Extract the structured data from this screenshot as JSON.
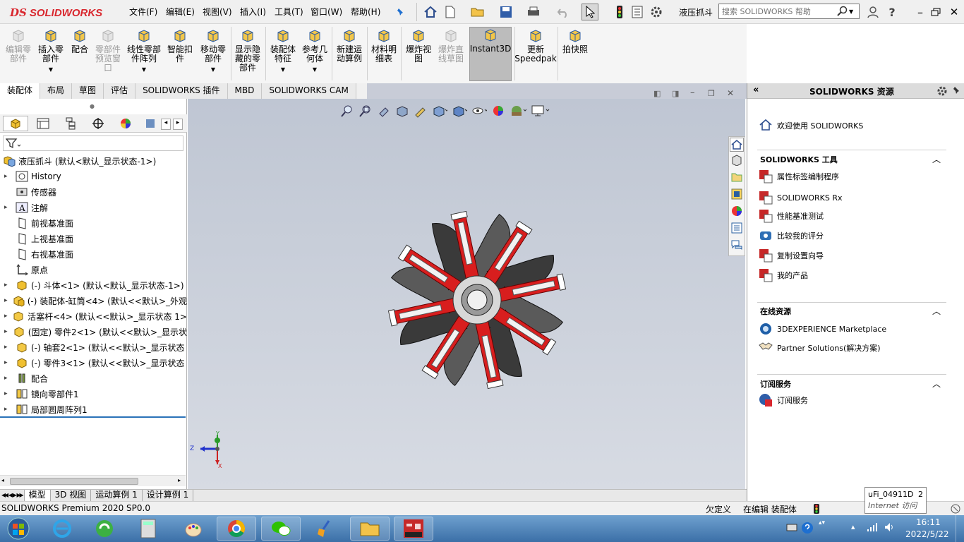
{
  "app": {
    "logo_ds": "DS",
    "logo_text": "SOLIDWORKS",
    "doc_name": "液压抓斗"
  },
  "menu": [
    "文件(F)",
    "编辑(E)",
    "视图(V)",
    "插入(I)",
    "工具(T)",
    "窗口(W)",
    "帮助(H)"
  ],
  "help_search": {
    "placeholder": "搜索 SOLIDWORKS 帮助"
  },
  "ribbon": [
    {
      "label": "编辑零\n部件",
      "disabled": true,
      "icon": "edit-component-icon"
    },
    {
      "label": "插入零\n部件",
      "disabled": false,
      "icon": "insert-component-icon",
      "arrow": true
    },
    {
      "label": "配合",
      "disabled": false,
      "icon": "mate-icon"
    },
    {
      "label": "零部件\n预览窗\n口",
      "disabled": true,
      "icon": "component-preview-icon"
    },
    {
      "label": "线性零部\n件阵列",
      "disabled": false,
      "icon": "linear-pattern-icon",
      "arrow": true
    },
    {
      "label": "智能扣\n件",
      "disabled": false,
      "icon": "smart-fastener-icon"
    },
    {
      "label": "移动零\n部件",
      "disabled": false,
      "icon": "move-component-icon",
      "arrow": true
    },
    {
      "label": "显示隐\n藏的零\n部件",
      "disabled": false,
      "icon": "show-hidden-icon"
    },
    {
      "label": "装配体\n特征",
      "disabled": false,
      "icon": "assembly-feature-icon",
      "arrow": true
    },
    {
      "label": "参考几\n何体",
      "disabled": false,
      "icon": "reference-geometry-icon",
      "arrow": true
    },
    {
      "label": "新建运\n动算例",
      "disabled": false,
      "icon": "motion-study-icon"
    },
    {
      "label": "材料明\n细表",
      "disabled": false,
      "icon": "bom-icon"
    },
    {
      "label": "爆炸视\n图",
      "disabled": false,
      "icon": "exploded-view-icon"
    },
    {
      "label": "爆炸直\n线草图",
      "disabled": true,
      "icon": "explode-line-icon"
    },
    {
      "label": "Instant3D",
      "disabled": false,
      "icon": "instant3d-icon"
    },
    {
      "label": "更新\nSpeedpak",
      "disabled": false,
      "icon": "speedpak-icon"
    },
    {
      "label": "拍快照",
      "disabled": false,
      "icon": "snapshot-icon"
    }
  ],
  "tabs": [
    "装配体",
    "布局",
    "草图",
    "评估",
    "SOLIDWORKS 插件",
    "MBD",
    "SOLIDWORKS CAM"
  ],
  "tree": {
    "root": "液压抓斗  (默认<默认_显示状态-1>)",
    "items": [
      {
        "label": "History",
        "exp": "▸"
      },
      {
        "label": "传感器",
        "exp": ""
      },
      {
        "label": "注解",
        "exp": "▸"
      },
      {
        "label": "前视基准面",
        "exp": ""
      },
      {
        "label": "上视基准面",
        "exp": ""
      },
      {
        "label": "右视基准面",
        "exp": ""
      },
      {
        "label": "原点",
        "exp": ""
      },
      {
        "label": "(-) 斗体<1> (默认<默认_显示状态-1>)",
        "exp": "▸"
      },
      {
        "label": "(-) 装配体-缸筒<4> (默认<<默认>_外观",
        "exp": "▸"
      },
      {
        "label": "活塞杆<4> (默认<<默认>_显示状态 1>",
        "exp": "▸"
      },
      {
        "label": "(固定) 零件2<1> (默认<<默认>_显示状",
        "exp": "▸"
      },
      {
        "label": "(-) 轴套2<1> (默认<<默认>_显示状态",
        "exp": "▸"
      },
      {
        "label": "(-) 零件3<1> (默认<<默认>_显示状态",
        "exp": "▸"
      },
      {
        "label": "配合",
        "exp": "▸"
      },
      {
        "label": "镜向零部件1",
        "exp": "▸"
      },
      {
        "label": "局部圆周阵列1",
        "exp": "▸"
      }
    ]
  },
  "triad": {
    "z": "Z",
    "y": "Y",
    "x": "X"
  },
  "resources": {
    "title": "SOLIDWORKS 资源",
    "welcome": "欢迎使用  SOLIDWORKS",
    "tools_title": "SOLIDWORKS 工具",
    "tools": [
      "属性标签编制程序",
      "SOLIDWORKS Rx",
      "性能基准测试",
      "比较我的评分",
      "复制设置向导",
      "我的产品"
    ],
    "online_title": "在线资源",
    "online": [
      "3DEXPERIENCE Marketplace",
      "Partner Solutions(解决方案)"
    ],
    "sub_title": "订阅服务",
    "sub": [
      "订阅服务"
    ]
  },
  "bottom_tabs": [
    "模型",
    "3D 视图",
    "运动算例 1",
    "设计算例 1"
  ],
  "status": {
    "left": "SOLIDWORKS Premium 2020 SP0.0",
    "custom": "欠定义",
    "editing": "在编辑 装配体"
  },
  "tooltip": {
    "line1": "uFi_04911D",
    "num": "2",
    "line2": "Internet 访问"
  },
  "clock": {
    "time": "16:11",
    "date": "2022/5/22"
  },
  "colors": {
    "accent_red": "#d9272e",
    "viewport_top": "#bfc6d3",
    "taskbar": "#3b6fa7"
  }
}
